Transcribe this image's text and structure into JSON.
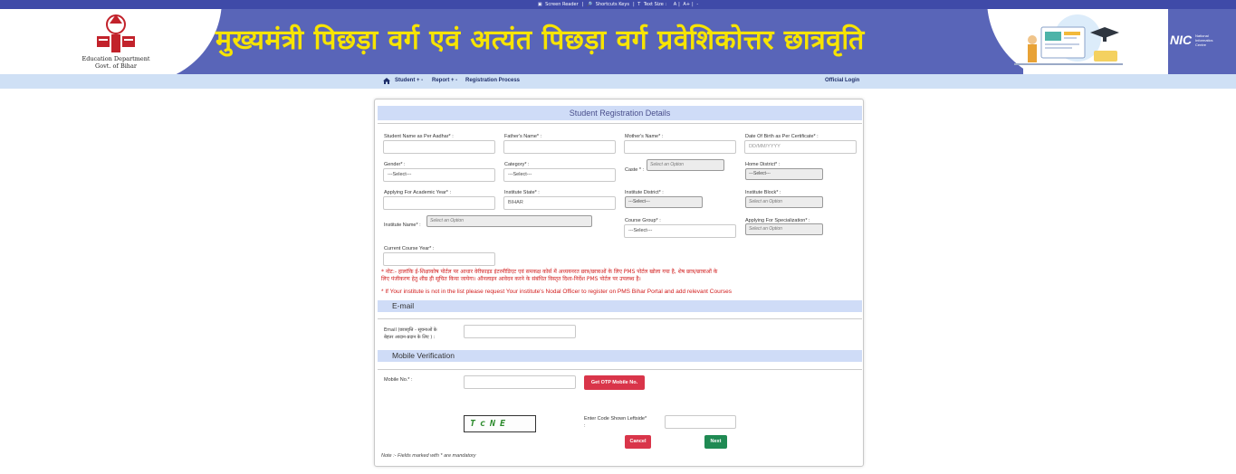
{
  "topbar": {
    "screen_reader": "Screen Reader",
    "shortcut_keys": "Shortcuts Keys",
    "text_size": "Text Size :",
    "size_small": "A",
    "size_normal": "A+",
    "size_large": "-"
  },
  "header": {
    "dept_line1": "Education Department",
    "dept_line2": "Govt. of Bihar",
    "title_hindi": "मुख्यमंत्री पिछड़ा वर्ग एवं अत्यंत पिछड़ा वर्ग प्रवेशिकोत्तर छात्रवृति",
    "nic_mark": "NIC",
    "nic_line1": "National",
    "nic_line2": "Informatics",
    "nic_line3": "Centre"
  },
  "nav": {
    "student": "Student + -",
    "report": "Report + -",
    "registration_process": "Registration Process",
    "official_login": "Official Login"
  },
  "form": {
    "title": "Student Registration Details",
    "fields": {
      "student_name_label": "Student Name as Per Aadhar* :",
      "fathers_name_label": "Father's Name* :",
      "mothers_name_label": "Mother's Name* :",
      "dob_label": "Date Of Birth as Per Certificate* :",
      "dob_placeholder": "DD/MM/YYYY",
      "gender_label": "Gender* :",
      "gender_value": "---Select---",
      "category_label": "Category* :",
      "category_value": "---Select---",
      "caste_label": "Caste * :",
      "caste_value": "Select an Option",
      "home_district_label": "Home District* :",
      "home_district_value": "---Select---",
      "academic_year_label": "Applying For Academic Year* :",
      "institute_state_label": "Institute State* :",
      "institute_state_value": "BIHAR",
      "institute_district_label": "Institute District* :",
      "institute_district_value": "---Select---",
      "institute_block_label": "Institute Block* :",
      "institute_block_value": "Select an Option",
      "institute_name_label": "Institute Name* :",
      "institute_name_value": "Select an Option",
      "course_group_label": "Course Group* :",
      "course_group_value": "---Select---",
      "specialization_label": "Applying For Specialization* :",
      "specialization_value": "Select an Option",
      "course_year_label": "Current Course Year* :"
    },
    "note_hindi_1": "* नोट:- हालांकि ई-शिक्षाकोष पोर्टल पर आधार वेरीफ़ाइड इंटरमीडिएट एवं समकक्ष कोर्स में अध्ययनरत छात्र/छात्राओं के लिए PMS पोर्टल खोला गया है, शेष छात्र/छात्राओं के",
    "note_hindi_2": "लिए पंजीकरण हेतु शीघ्र ही सूचित किया जायेगा। ऑनलाइन आवेदन करने के संबंधित विस्तृत दिशा-निर्देश PMS पोर्टल पर उपलब्ध है।",
    "note_english": "* If Your institute is not in the list please request Your institute's Nodal Officer to register on PMS Bihar Portal and add relevant Courses",
    "email_section": "E-mail",
    "email_label_1": "Email (छात्रवृत्ति - सूचनाओं के",
    "email_label_2": "बेहतर आदान-प्रदान के लिए ) :",
    "mobile_section": "Mobile Verification",
    "mobile_label": "Mobile No.* :",
    "otp_button": "Get OTP Mobile No.",
    "captcha_text": "TcNE",
    "captcha_label": "Enter Code Shown Leftside*",
    "captcha_colon": ":",
    "cancel_button": "Cancel",
    "next_button": "Next",
    "footnote": "Note :- Fields marked with * are mandatory"
  },
  "colors": {
    "banner_band": "#5965b8",
    "title_yellow": "#f7e400",
    "navbar": "#cfe0f5",
    "section_header": "#cfdcf7",
    "danger": "#d9354a",
    "success": "#1f8a53",
    "note_red": "#d11b1b"
  }
}
